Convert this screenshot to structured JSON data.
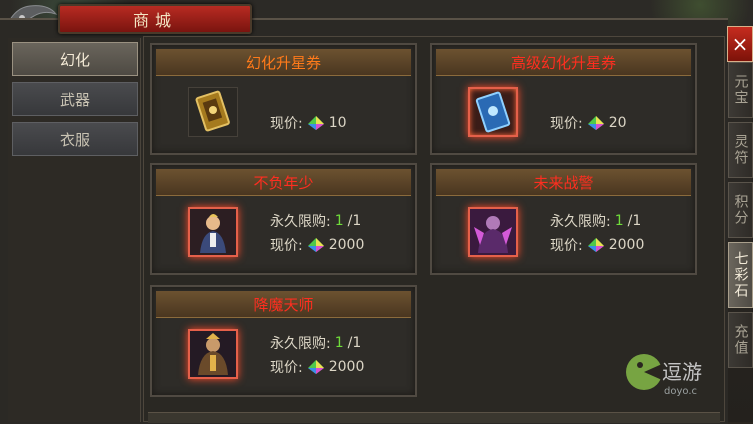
{
  "window": {
    "title": "商城"
  },
  "categories": [
    {
      "label": "幻化",
      "active": true
    },
    {
      "label": "武器",
      "active": false
    },
    {
      "label": "衣服",
      "active": false
    }
  ],
  "side_tabs": [
    {
      "label": "元宝",
      "active": false
    },
    {
      "label": "灵符",
      "active": false
    },
    {
      "label": "积分",
      "active": false
    },
    {
      "label": "七彩石",
      "active": true
    },
    {
      "label": "充值",
      "active": false
    }
  ],
  "items": [
    {
      "name": "幻化升星券",
      "price_label": "现价:",
      "price": "10"
    },
    {
      "name": "高级幻化升星券",
      "price_label": "现价:",
      "price": "20"
    },
    {
      "name": "不负年少",
      "limit_label": "永久限购:",
      "limit_bought": "1",
      "limit_total": "/1",
      "price_label": "现价:",
      "price": "2000"
    },
    {
      "name": "未来战警",
      "limit_label": "永久限购:",
      "limit_bought": "1",
      "limit_total": "/1",
      "price_label": "现价:",
      "price": "2000"
    },
    {
      "name": "降魔天师",
      "limit_label": "永久限购:",
      "limit_bought": "1",
      "limit_total": "/1",
      "price_label": "现价:",
      "price": "2000"
    }
  ],
  "close_label": "×",
  "watermark": {
    "text": "逗游",
    "sub": "doyo.c"
  },
  "icons": {
    "currency": "rainbow-gem-icon",
    "close": "close-icon"
  },
  "colors": {
    "accent_red": "#b82b22",
    "name_orange": "#ff7a1a",
    "name_red": "#ff2e20",
    "limit_green": "#6fdc3a"
  }
}
